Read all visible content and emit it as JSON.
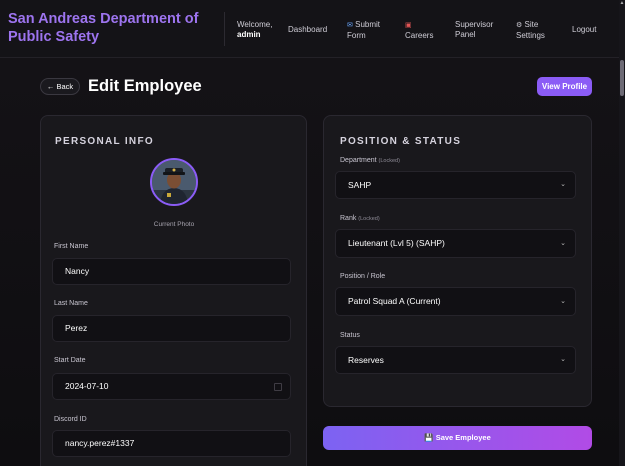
{
  "header": {
    "brand": "San Andreas Department of Public Safety",
    "welcome_label": "Welcome,",
    "welcome_user": "admin",
    "nav": {
      "dashboard": "Dashboard",
      "submit_line1": "Submit",
      "submit_line2": "Form",
      "careers": "Careers",
      "supervisor_line1": "Supervisor",
      "supervisor_line2": "Panel",
      "site_line1": "Site",
      "site_line2": "Settings",
      "logout": "Logout"
    }
  },
  "page": {
    "back_label": "← Back",
    "title": "Edit Employee",
    "view_profile_label": "View Profile"
  },
  "personal_info": {
    "section_title": "PERSONAL INFO",
    "photo_caption": "Current Photo",
    "first_name_label": "First Name",
    "first_name_value": "Nancy",
    "last_name_label": "Last Name",
    "last_name_value": "Perez",
    "start_date_label": "Start Date",
    "start_date_value": "2024-07-10",
    "discord_label": "Discord ID",
    "discord_value": "nancy.perez#1337"
  },
  "position_status": {
    "section_title": "POSITION & STATUS",
    "department_label": "Department",
    "department_note": "(Locked)",
    "department_value": "SAHP",
    "rank_label": "Rank",
    "rank_note": "(Locked)",
    "rank_value": "Lieutenant (Lvl 5) (SAHP)",
    "position_label": "Position / Role",
    "position_value": "Patrol Squad A (Current)",
    "status_label": "Status",
    "status_value": "Reserves"
  },
  "actions": {
    "save_label": "Save Employee"
  },
  "colors": {
    "accent": "#8b5cf6",
    "accent_gradient_end": "#b14be6",
    "background": "#0c0b0e",
    "card": "#19181c"
  },
  "icons": [
    "submit-form-icon",
    "careers-icon",
    "gear-icon",
    "save-icon",
    "chevron-down-icon",
    "calendar-icon"
  ]
}
